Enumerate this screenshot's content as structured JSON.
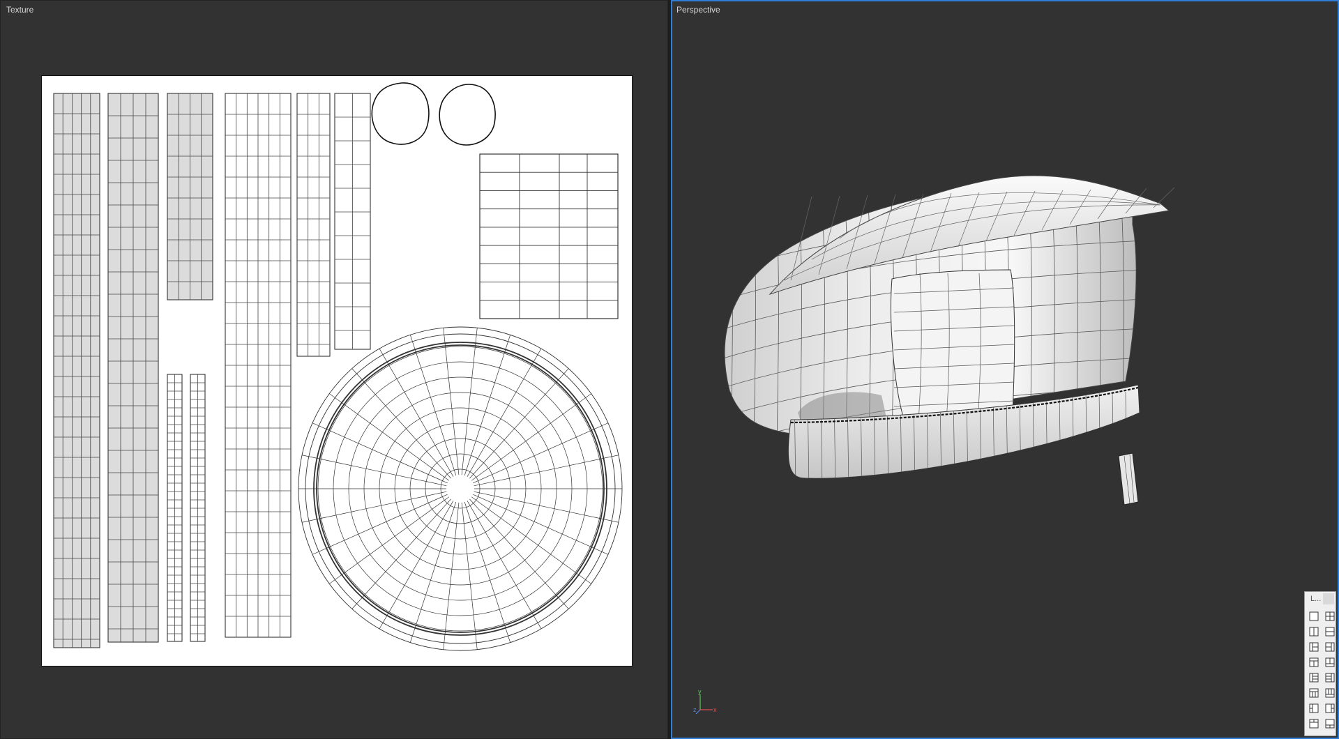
{
  "viewports": {
    "texture": {
      "title": "Texture"
    },
    "perspective": {
      "title": "Perspective"
    }
  },
  "axis": {
    "x_label": "x",
    "y_label": "y",
    "z_label": "z"
  },
  "layout_panel": {
    "header": "L...",
    "options": [
      "single-layout-icon",
      "four-split-layout-icon",
      "two-vertical-layout-icon",
      "two-horizontal-layout-icon",
      "three-left-layout-icon",
      "three-right-layout-icon",
      "three-top-layout-icon",
      "three-bottom-layout-icon",
      "four-left-layout-icon",
      "four-right-layout-icon",
      "four-top-layout-icon",
      "four-bottom-layout-icon",
      "four-left-alt-layout-icon",
      "four-right-alt-layout-icon",
      "four-top-alt-layout-icon",
      "four-bottom-alt-layout-icon"
    ]
  },
  "colors": {
    "viewport_bg": "#323232",
    "active_border": "#2f7fd8",
    "uv_sheet": "#ffffff",
    "uv_shell_fill": "#dcdcdc"
  }
}
